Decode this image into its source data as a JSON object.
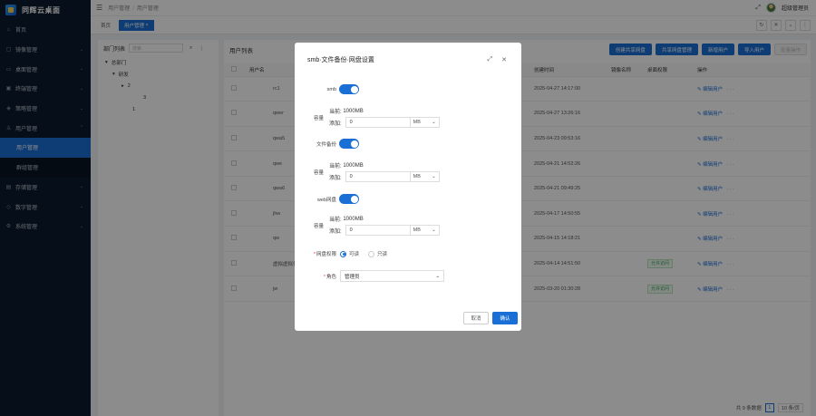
{
  "app": {
    "title": "同辉云桌面"
  },
  "sidebar": {
    "items": [
      {
        "label": "首页",
        "icon": "home-icon",
        "glyph": "⌂"
      },
      {
        "label": "镜像管理",
        "icon": "image-icon",
        "glyph": "▢"
      },
      {
        "label": "桌面管理",
        "icon": "desktop-icon",
        "glyph": "▭"
      },
      {
        "label": "终端管理",
        "icon": "terminal-icon",
        "glyph": "▣"
      },
      {
        "label": "策略管理",
        "icon": "policy-icon",
        "glyph": "◈"
      },
      {
        "label": "用户管理",
        "icon": "user-icon",
        "glyph": "♙"
      },
      {
        "label": "用户管理",
        "icon": "",
        "glyph": ""
      },
      {
        "label": "群组管理",
        "icon": "",
        "glyph": ""
      },
      {
        "label": "存储管理",
        "icon": "storage-icon",
        "glyph": "▤"
      },
      {
        "label": "数字管理",
        "icon": "digital-icon",
        "glyph": "◇"
      },
      {
        "label": "系统管理",
        "icon": "settings-icon",
        "glyph": "⚙"
      }
    ]
  },
  "topbar": {
    "breadcrumb": [
      "用户管理",
      "用户管理"
    ],
    "username": "超级管理员"
  },
  "tabs": {
    "home": "首页",
    "active": "用户管理"
  },
  "dept": {
    "title": "部门列表",
    "search_placeholder": "搜索",
    "tree": [
      "总部门",
      "研发",
      "2",
      "3",
      "1"
    ]
  },
  "users": {
    "title": "用户列表",
    "actions": [
      "创建共享网盘",
      "共享网盘管理",
      "新增用户",
      "导入用户",
      "批量操作"
    ],
    "columns": [
      "用户名",
      "创建时间",
      "镜像名称",
      "桌面权限",
      "操作"
    ],
    "rows": [
      {
        "name": "rc1",
        "time": "2025-04-27 14:17:00",
        "perm": ""
      },
      {
        "name": "qwer",
        "time": "2025-04-27 13:26:16",
        "perm": ""
      },
      {
        "name": "qwa5",
        "time": "2025-04-23 09:53:16",
        "perm": ""
      },
      {
        "name": "qwe",
        "time": "2025-04-21 14:52:26",
        "perm": ""
      },
      {
        "name": "qwa6",
        "time": "2025-04-21 09:49:25",
        "perm": ""
      },
      {
        "name": "jhw",
        "time": "2025-04-17 14:50:55",
        "perm": ""
      },
      {
        "name": "qw",
        "time": "2025-04-15 14:18:21",
        "perm": ""
      },
      {
        "name": "虚拟虚拟化",
        "time": "2025-04-14 14:51:50",
        "perm": "允许访问"
      },
      {
        "name": "jw",
        "time": "2025-03-20 01:30:28",
        "perm": "允许访问"
      }
    ],
    "edit_label": "编辑用户",
    "more_label": "···",
    "total": "共 9 条数据",
    "page": "1",
    "page_size": "10 条/页"
  },
  "modal": {
    "title": "smb·文件备份·网盘设置",
    "smb_label": "smb",
    "backup_label": "文件备份",
    "netdisk_label": "web网盘",
    "capacity_label": "容量",
    "current_label": "当前:",
    "current_value": "1000MB",
    "add_label": "添加:",
    "add_value": "0",
    "unit": "MB",
    "perm_label": "网盘权限",
    "perm_options": [
      "可读",
      "只读"
    ],
    "role_label": "角色",
    "role_value": "管理员",
    "cancel": "取消",
    "confirm": "确认"
  }
}
